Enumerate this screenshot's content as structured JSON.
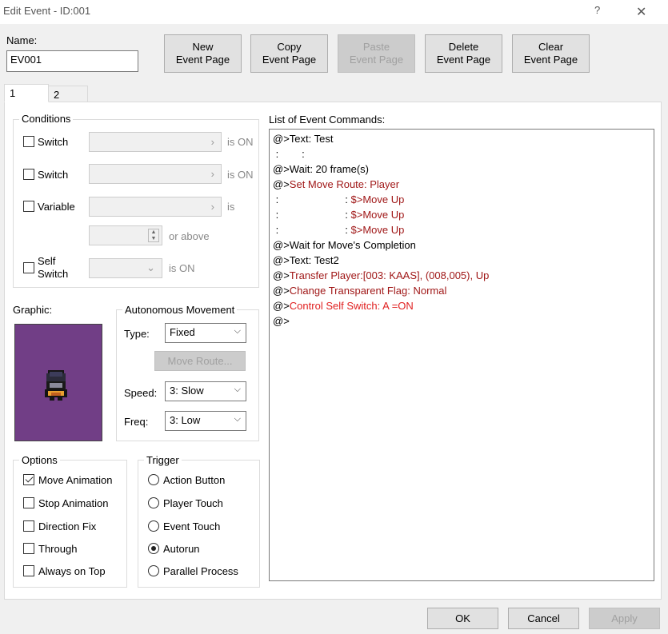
{
  "window": {
    "title": "Edit Event - ID:001",
    "help": "?",
    "close": "✕"
  },
  "name": {
    "label": "Name:",
    "value": "EV001"
  },
  "toolbar": {
    "new": [
      "New",
      "Event Page"
    ],
    "copy": [
      "Copy",
      "Event Page"
    ],
    "paste": [
      "Paste",
      "Event Page"
    ],
    "delete": [
      "Delete",
      "Event Page"
    ],
    "clear": [
      "Clear",
      "Event Page"
    ]
  },
  "tabs": [
    "1",
    "2"
  ],
  "conditions": {
    "label": "Conditions",
    "switch1": {
      "label": "Switch",
      "suffix": "is ON"
    },
    "switch2": {
      "label": "Switch",
      "suffix": "is ON"
    },
    "variable": {
      "label": "Variable",
      "suffix": "is",
      "or_above": "or above"
    },
    "self_switch": {
      "label1": "Self",
      "label2": "Switch",
      "suffix": "is ON"
    }
  },
  "graphic": {
    "label": "Graphic:"
  },
  "autonomous": {
    "label": "Autonomous Movement",
    "type_label": "Type:",
    "type_value": "Fixed",
    "move_route": "Move Route...",
    "speed_label": "Speed:",
    "speed_value": "3: Slow",
    "freq_label": "Freq:",
    "freq_value": "3: Low"
  },
  "options": {
    "label": "Options",
    "items": [
      "Move Animation",
      "Stop Animation",
      "Direction Fix",
      "Through",
      "Always on Top"
    ],
    "checked": [
      true,
      false,
      false,
      false,
      false
    ]
  },
  "trigger": {
    "label": "Trigger",
    "items": [
      "Action Button",
      "Player Touch",
      "Event Touch",
      "Autorun",
      "Parallel Process"
    ],
    "selected": "Autorun"
  },
  "commands": {
    "label": "List of Event Commands:",
    "lines": [
      {
        "prefix": "@>",
        "text": "Text: Test",
        "color": "black"
      },
      {
        "prefix": " :        :",
        "text": "",
        "color": "black"
      },
      {
        "prefix": "@>",
        "text": "Wait: 20 frame(s)",
        "color": "black"
      },
      {
        "prefix": "@>",
        "text": "Set Move Route: Player",
        "color": "red"
      },
      {
        "prefix": " :                       : ",
        "text": "$>Move Up",
        "color": "red"
      },
      {
        "prefix": " :                       : ",
        "text": "$>Move Up",
        "color": "red"
      },
      {
        "prefix": " :                       : ",
        "text": "$>Move Up",
        "color": "red"
      },
      {
        "prefix": "@>",
        "text": "Wait for Move's Completion",
        "color": "black"
      },
      {
        "prefix": "@>",
        "text": "Text: Test2",
        "color": "black"
      },
      {
        "prefix": "@>",
        "text": "Transfer Player:[003: KAAS], (008,005), Up",
        "color": "red"
      },
      {
        "prefix": "@>",
        "text": "Change Transparent Flag: Normal",
        "color": "red"
      },
      {
        "prefix": "@>",
        "text": "Control Self Switch: A =ON",
        "color": "brightred"
      },
      {
        "prefix": "@>",
        "text": "",
        "color": "black"
      }
    ]
  },
  "footer": {
    "ok": "OK",
    "cancel": "Cancel",
    "apply": "Apply"
  },
  "colors": {
    "red_command": "#b32020",
    "bright_red_command": "#e02020",
    "graphic_bg": "#713e86"
  }
}
